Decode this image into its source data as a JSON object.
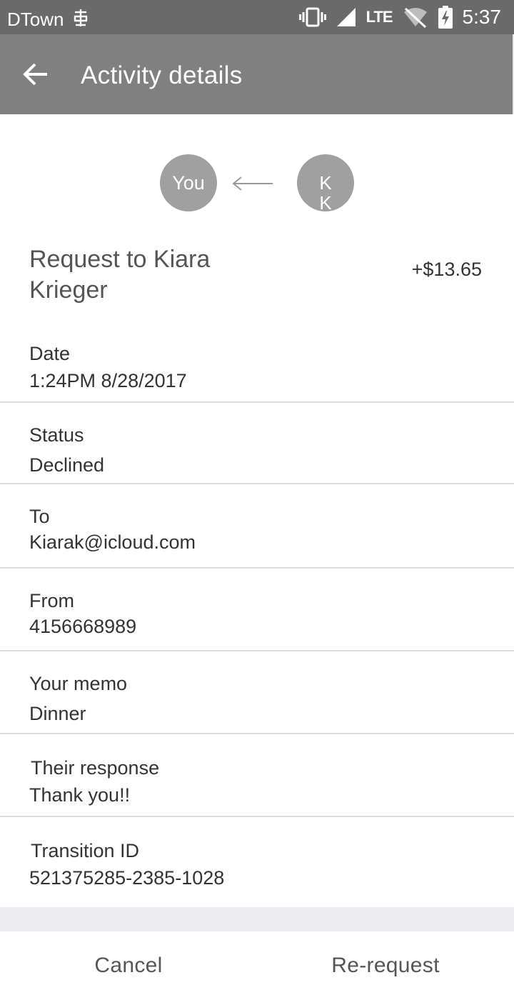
{
  "status_bar": {
    "carrier": "DTown",
    "network": "LTE",
    "time": "5:37",
    "icons": [
      "carrier-signal-icon",
      "vibrate-icon",
      "cell-signal-icon",
      "lte-icon",
      "wifi-off-icon",
      "battery-charging-icon"
    ]
  },
  "app_bar": {
    "title": "Activity details",
    "back_icon": "arrow-back-icon"
  },
  "participants": {
    "from_avatar": "You",
    "to_avatar": "KK",
    "direction_icon": "arrow-left-icon"
  },
  "request": {
    "title": "Request to Kiara Krieger",
    "amount": "+$13.65"
  },
  "details": [
    {
      "label": "Date",
      "value": "1:24PM 8/28/2017"
    },
    {
      "label": "Status",
      "value": "Declined"
    },
    {
      "label": "To",
      "value": "Kiarak@icloud.com"
    },
    {
      "label": "From",
      "value": "4156668989"
    },
    {
      "label": "Your memo",
      "value": "Dinner"
    },
    {
      "label": "Their response",
      "value": "Thank you!!"
    },
    {
      "label": "Transition ID",
      "value": "521375285-2385-1028"
    }
  ],
  "actions": {
    "cancel_label": "Cancel",
    "rerequest_label": "Re-request"
  },
  "colors": {
    "status_bar_bg": "#6a6a6a",
    "app_bar_bg": "#808080",
    "avatar_bg": "#a0a0a0",
    "divider": "#dddddd",
    "bottom_strip": "#ebebf0"
  }
}
